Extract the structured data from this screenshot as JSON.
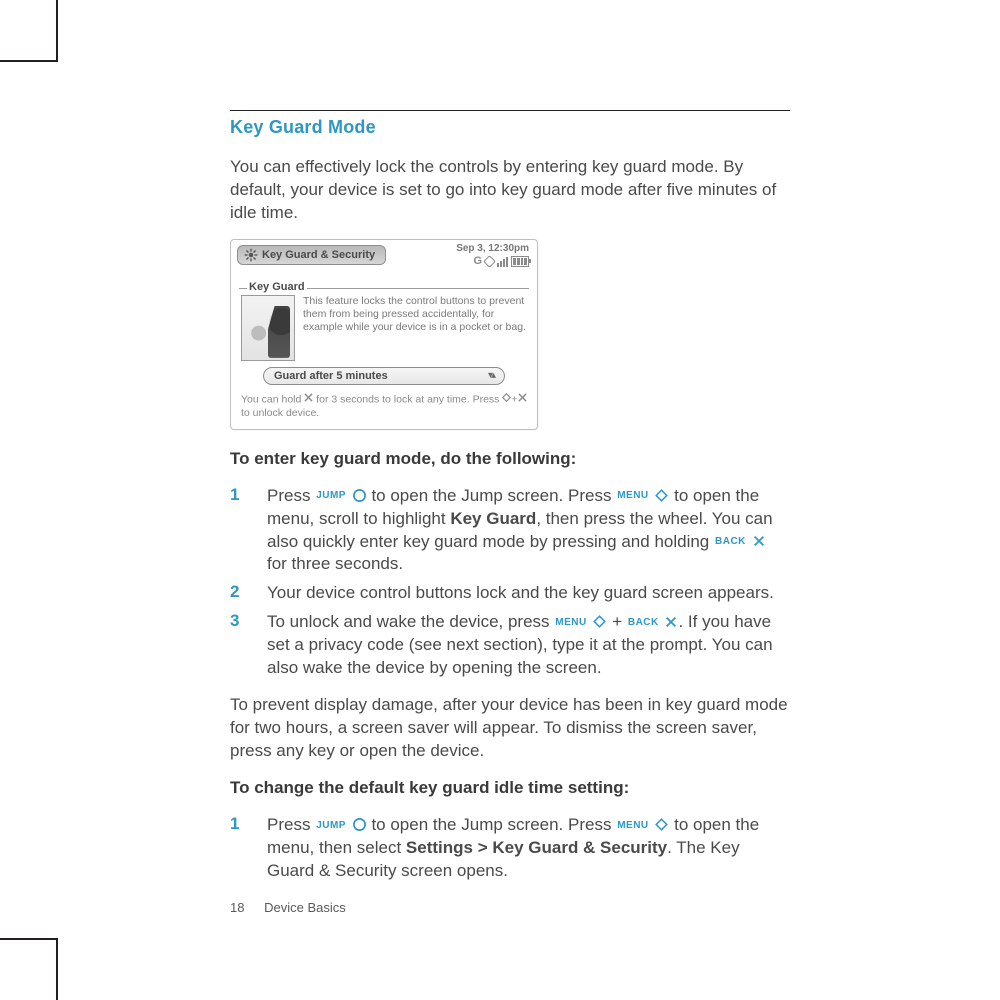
{
  "section_title": "Key Guard Mode",
  "intro": "You can effectively lock the controls by entering key guard mode. By default, your device is set to go into key guard mode after five minutes of idle time.",
  "screenshot": {
    "tab_title": "Key Guard & Security",
    "datetime": "Sep 3, 12:30pm",
    "carrier_glyph": "G",
    "group_label": "Key Guard",
    "description": "This feature locks the control buttons to prevent them from being pressed accidentally, for example while your device is in a pocket or bag.",
    "pill_label": "Guard after 5 minutes",
    "hint_a": "You can hold ",
    "hint_b": " for 3 seconds to lock at any time.  Press ",
    "hint_c": "+",
    "hint_d": " to unlock device."
  },
  "heading_enter": "To enter key guard mode, do the following:",
  "steps_enter": [
    {
      "n": "1",
      "pre": "Press ",
      "k1": "JUMP",
      "mid1": " to open the Jump screen. Press ",
      "k2": "MENU",
      "mid2": " to open the menu, scroll to highlight ",
      "bold1": "Key Guard",
      "mid3": ", then press the wheel. You can also quickly enter key guard mode by pressing and holding ",
      "k3": "BACK",
      "tail": " for three seconds."
    },
    {
      "n": "2",
      "text": "Your device control buttons lock and the key guard screen appears."
    },
    {
      "n": "3",
      "pre": "To unlock and wake the device, press ",
      "k1": "MENU",
      "plus": " + ",
      "k2": "BACK",
      "tail": ". If you have set a privacy code (see next section), type it at the prompt. You can also wake the device by opening the screen."
    }
  ],
  "para_saver": "To prevent display damage, after your device has been in key guard mode for two hours, a screen saver will appear. To dismiss the screen saver, press any key or open the device.",
  "heading_change": "To change the default key guard idle time setting:",
  "steps_change": [
    {
      "n": "1",
      "pre": "Press ",
      "k1": "JUMP",
      "mid1": " to open the Jump screen. Press ",
      "k2": "MENU",
      "mid2": " to open the menu, then select ",
      "bold1": "Settings > Key Guard & Security",
      "tail": ". The Key Guard & Security screen opens."
    }
  ],
  "footer": {
    "page": "18",
    "label": "Device Basics"
  }
}
